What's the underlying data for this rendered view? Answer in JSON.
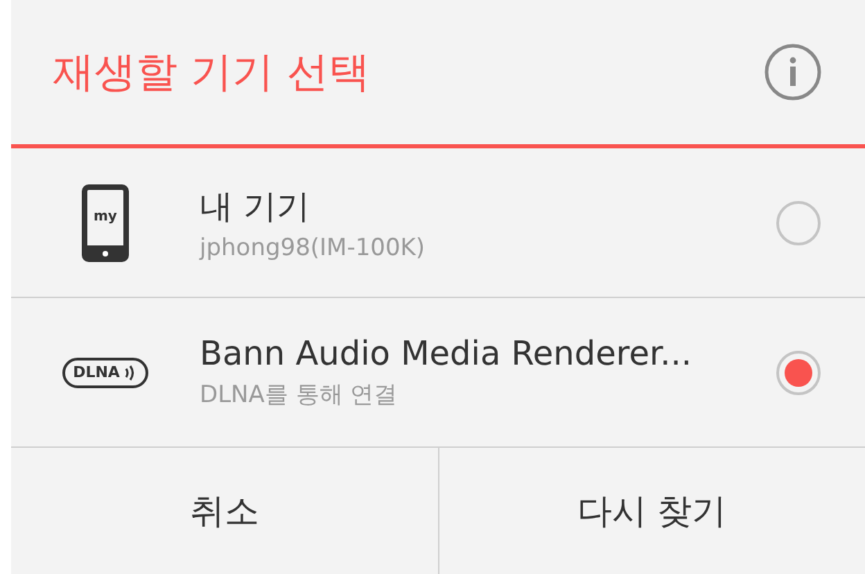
{
  "dialog": {
    "title": "재생할 기기 선택"
  },
  "devices": [
    {
      "kind": "phone",
      "icon_label": "my",
      "name": "내 기기",
      "detail": "jphong98(IM-100K)",
      "selected": false
    },
    {
      "kind": "dlna",
      "icon_label": "DLNA",
      "name": "Bann Audio Media Renderer...",
      "detail": "DLNA를 통해 연결",
      "selected": true
    }
  ],
  "buttons": [
    "취소",
    "다시 찾기"
  ]
}
